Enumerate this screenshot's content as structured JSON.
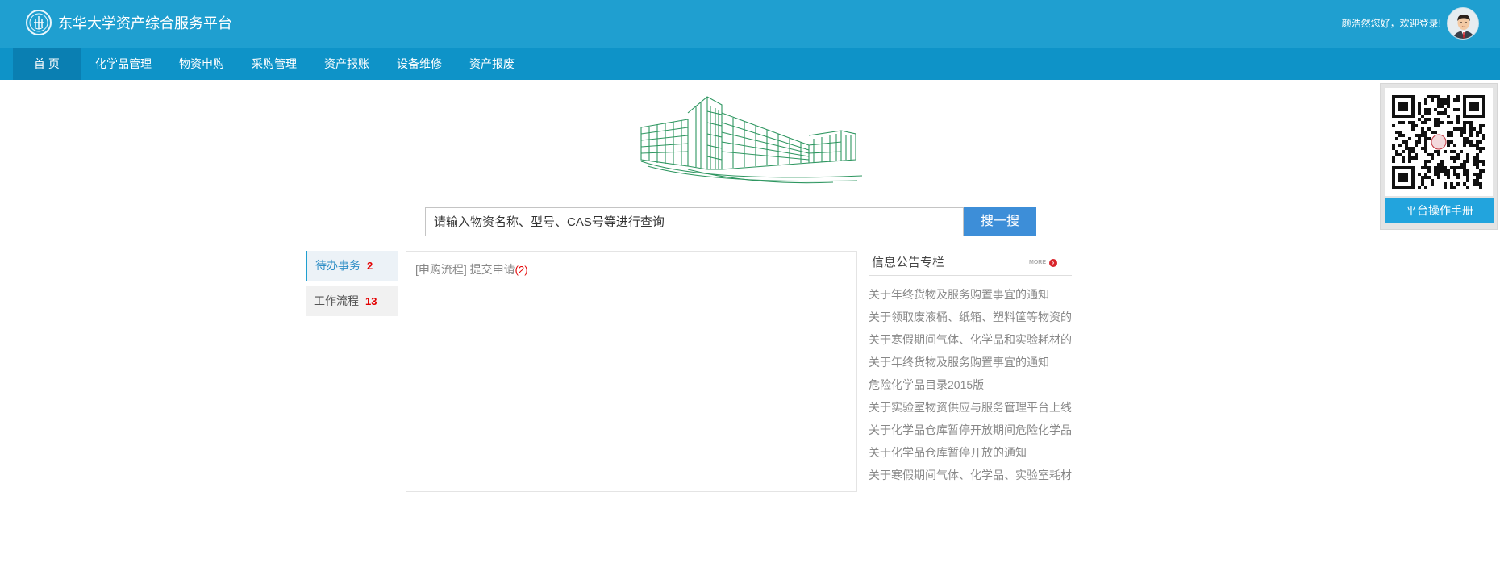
{
  "header": {
    "app_title": "东华大学资产综合服务平台",
    "welcome_text": "颜浩然您好，欢迎登录!",
    "bg_color": "#1f9fd0"
  },
  "nav": {
    "items": [
      "首 页",
      "化学品管理",
      "物资申购",
      "采购管理",
      "资产报账",
      "设备维修",
      "资产报废"
    ],
    "active_item": "首 页",
    "bg_color": "#0e93c8"
  },
  "search": {
    "placeholder": "请输入物资名称、型号、CAS号等进行查询",
    "button_label": "搜一搜"
  },
  "sidebar_tabs": [
    {
      "label": "待办事务",
      "count": "2",
      "active": true
    },
    {
      "label": "工作流程",
      "count": "13",
      "active": false
    }
  ],
  "tasks": [
    {
      "category": "[申购流程]",
      "label": "提交申请",
      "count": "(2)"
    }
  ],
  "notices": {
    "title": "信息公告专栏",
    "more_label": "MORE",
    "items": [
      "关于年终货物及服务购置事宜的通知",
      "关于领取废液桶、纸箱、塑料筐等物资的",
      "关于寒假期间气体、化学品和实验耗材的",
      "关于年终货物及服务购置事宜的通知",
      "危险化学品目录2015版",
      "关于实验室物资供应与服务管理平台上线",
      "关于化学品仓库暂停开放期间危险化学品",
      "关于化学品仓库暂停开放的通知",
      "关于寒假期间气体、化学品、实验室耗材"
    ]
  },
  "qr": {
    "manual_label": "平台操作手册"
  },
  "colors": {
    "accent": "#3d8ed8",
    "count_red": "#e40000",
    "illustration_green": "#2e9660"
  }
}
